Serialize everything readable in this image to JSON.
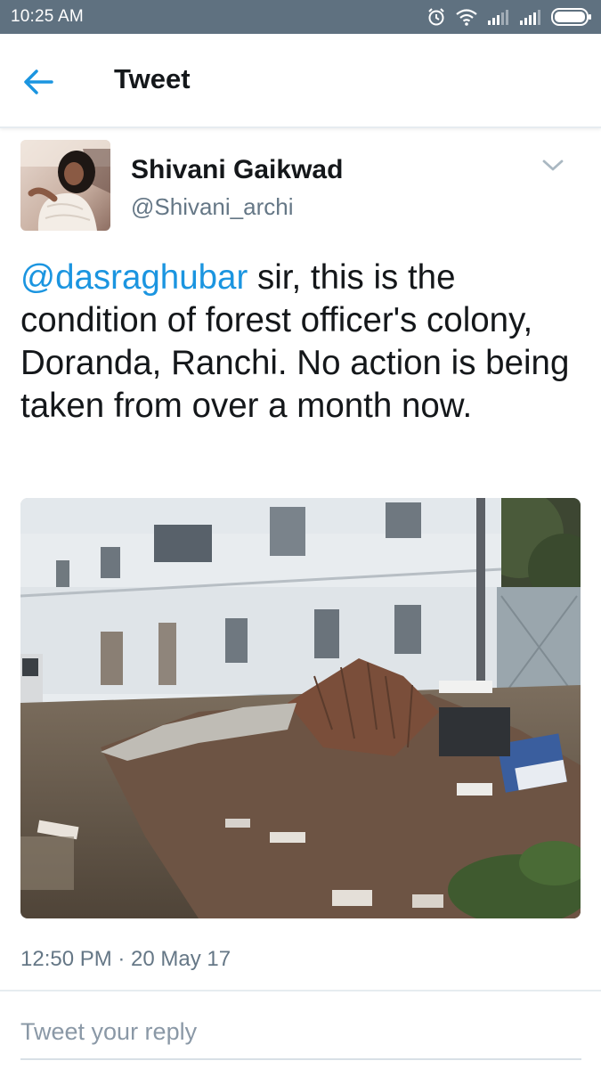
{
  "status_bar": {
    "time": "10:25 AM",
    "icons": [
      "alarm-icon",
      "wifi-icon",
      "signal-icon",
      "signal-icon",
      "battery-icon"
    ]
  },
  "app_bar": {
    "title": "Tweet",
    "back_icon": "back-arrow-icon"
  },
  "tweet": {
    "author": {
      "display_name": "Shivani Gaikwad",
      "handle": "@Shivani_archi"
    },
    "mention": "@dasraghubar",
    "body": " sir, this is the condition of forest officer's colony, Doranda, Ranchi. No action is being taken from over a month now.",
    "timestamp": "12:50 PM · 20 May 17"
  },
  "reply": {
    "placeholder": "Tweet your reply"
  },
  "colors": {
    "status_bar": "#5f7180",
    "accent": "#1b95e0",
    "secondary_text": "#657786"
  }
}
